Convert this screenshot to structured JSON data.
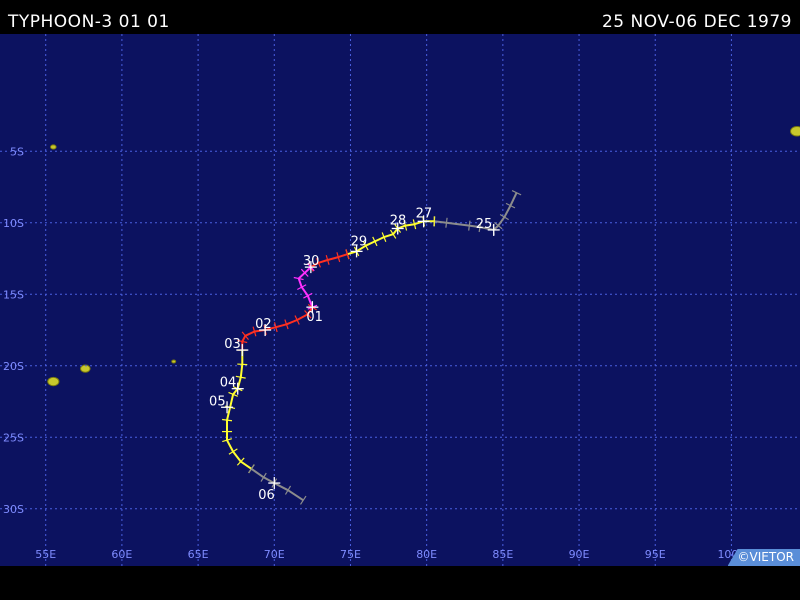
{
  "header": {
    "title": "TYPHOON-3 01 01",
    "date_range": "25 NOV-06 DEC 1979"
  },
  "credit": "©VIETOR",
  "colors": {
    "ocean": "#0c1260",
    "grid": "#4a5fe0",
    "label": "#7f8cff",
    "land": "#c8c82c",
    "track_gray": "#8c8c8c",
    "track_yellow": "#ffff30",
    "track_red": "#ff3020",
    "track_magenta": "#ff30ff",
    "day_label": "#ffffff"
  },
  "map": {
    "lon_range": [
      52,
      104.5
    ],
    "lat_range": [
      -34,
      3.2
    ],
    "lon_ticks": [
      55,
      60,
      65,
      70,
      75,
      80,
      85,
      90,
      95,
      100
    ],
    "lon_labels": [
      "55E",
      "60E",
      "65E",
      "70E",
      "75E",
      "80E",
      "85E",
      "90E",
      "95E",
      "100E"
    ],
    "lat_ticks": [
      -5,
      -10,
      -15,
      -20,
      -25,
      -30
    ],
    "lat_labels": [
      "5S",
      "10S",
      "15S",
      "20S",
      "25S",
      "30S"
    ]
  },
  "track": [
    {
      "color": "gray",
      "points": [
        [
          85.9,
          -7.9
        ],
        [
          85.5,
          -8.8
        ],
        [
          85.1,
          -9.6
        ],
        [
          84.7,
          -10.2
        ],
        [
          84.4,
          -10.5
        ],
        [
          83.5,
          -10.3
        ],
        [
          82.8,
          -10.2
        ],
        [
          81.3,
          -10.0
        ],
        [
          80.5,
          -9.9
        ]
      ]
    },
    {
      "color": "yellow",
      "points": [
        [
          80.5,
          -9.9
        ],
        [
          79.8,
          -9.9
        ],
        [
          79.2,
          -10.1
        ],
        [
          78.6,
          -10.2
        ],
        [
          78.1,
          -10.4
        ],
        [
          77.8,
          -10.8
        ],
        [
          77.2,
          -11.0
        ],
        [
          76.6,
          -11.3
        ],
        [
          76.0,
          -11.6
        ],
        [
          75.4,
          -12.0
        ],
        [
          74.8,
          -12.2
        ]
      ]
    },
    {
      "color": "red",
      "points": [
        [
          74.8,
          -12.2
        ],
        [
          74.2,
          -12.4
        ],
        [
          73.5,
          -12.6
        ],
        [
          72.9,
          -12.8
        ],
        [
          72.4,
          -13.1
        ]
      ]
    },
    {
      "color": "magenta",
      "points": [
        [
          72.4,
          -13.1
        ],
        [
          72.0,
          -13.5
        ],
        [
          71.6,
          -13.9
        ],
        [
          71.8,
          -14.5
        ],
        [
          72.2,
          -15.1
        ],
        [
          72.5,
          -15.9
        ]
      ]
    },
    {
      "color": "red",
      "points": [
        [
          72.5,
          -15.9
        ],
        [
          72.2,
          -16.4
        ],
        [
          71.5,
          -16.8
        ],
        [
          70.8,
          -17.1
        ],
        [
          70.1,
          -17.3
        ],
        [
          69.4,
          -17.5
        ],
        [
          68.7,
          -17.6
        ],
        [
          68.1,
          -17.9
        ],
        [
          67.9,
          -18.3
        ],
        [
          67.9,
          -18.9
        ]
      ]
    },
    {
      "color": "yellow",
      "points": [
        [
          67.9,
          -18.9
        ],
        [
          67.9,
          -19.9
        ],
        [
          67.8,
          -20.8
        ],
        [
          67.6,
          -21.6
        ],
        [
          67.3,
          -22.0
        ],
        [
          67.1,
          -22.9
        ],
        [
          66.9,
          -23.8
        ],
        [
          66.9,
          -24.6
        ],
        [
          66.9,
          -25.2
        ],
        [
          67.3,
          -26.0
        ],
        [
          67.8,
          -26.7
        ],
        [
          68.5,
          -27.2
        ]
      ]
    },
    {
      "color": "gray",
      "points": [
        [
          68.5,
          -27.2
        ],
        [
          69.3,
          -27.8
        ],
        [
          70.0,
          -28.2
        ],
        [
          70.9,
          -28.7
        ],
        [
          71.9,
          -29.4
        ]
      ]
    }
  ],
  "day_markers": [
    {
      "label": "25",
      "lon": 84.4,
      "lat": -10.5
    },
    {
      "label": "27",
      "lon": 79.8,
      "lat": -9.9
    },
    {
      "label": "28",
      "lon": 78.1,
      "lat": -10.4
    },
    {
      "label": "29",
      "lon": 75.4,
      "lat": -12.0
    },
    {
      "label": "30",
      "lon": 72.4,
      "lat": -13.1
    },
    {
      "label": "01",
      "lon": 72.5,
      "lat": -15.9
    },
    {
      "label": "02",
      "lon": 69.4,
      "lat": -17.5
    },
    {
      "label": "03",
      "lon": 67.9,
      "lat": -18.9
    },
    {
      "label": "04",
      "lon": 67.6,
      "lat": -21.6
    },
    {
      "label": "05",
      "lon": 66.9,
      "lat": -22.9
    },
    {
      "label": "06",
      "lon": 70.0,
      "lat": -28.2
    }
  ],
  "islands": [
    {
      "name": "mauritius",
      "lon": 57.6,
      "lat": -20.2,
      "size": 0.6
    },
    {
      "name": "reunion",
      "lon": 55.5,
      "lat": -21.1,
      "size": 0.7
    },
    {
      "name": "rodrigues",
      "lon": 63.4,
      "lat": -19.7,
      "size": 0.2
    },
    {
      "name": "seychelles",
      "lon": 55.5,
      "lat": -4.7,
      "size": 0.35
    },
    {
      "name": "sumatra-tip",
      "lon": 104.3,
      "lat": -3.6,
      "size": 0.8
    }
  ]
}
